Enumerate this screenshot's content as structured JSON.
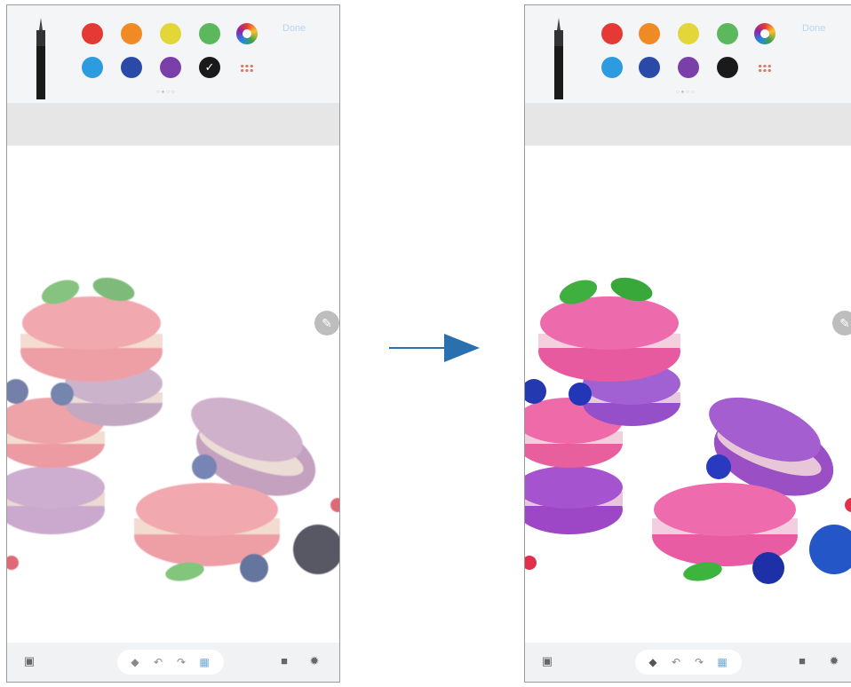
{
  "colors": {
    "palette_row1": [
      "#e53935",
      "#f08a24",
      "#e2d63a",
      "#5cb85c"
    ],
    "palette_row2": [
      "#2d9be0",
      "#2b4aa8",
      "#7a3fa8",
      "#1a1a1a"
    ],
    "arrow": "#2a6fae",
    "canvas_bg": "#ffffff",
    "toolbar_bg": "#f3f5f7"
  },
  "panels": [
    {
      "id": "before",
      "done_label": "Done",
      "selected_color": "black",
      "icons": [
        "pen-icon",
        "color-wheel-icon",
        "more-colors-icon",
        "edit-fab-icon",
        "gallery-icon",
        "eraser-icon",
        "undo-icon",
        "redo-icon",
        "image-icon",
        "folder-icon",
        "settings-icon"
      ]
    },
    {
      "id": "after",
      "done_label": "Done",
      "selected_color": "none",
      "icons": [
        "pen-icon",
        "color-wheel-icon",
        "more-colors-icon",
        "edit-fab-icon",
        "gallery-icon",
        "eraser-icon",
        "undo-icon",
        "redo-icon",
        "image-icon",
        "folder-icon",
        "settings-icon"
      ]
    }
  ]
}
